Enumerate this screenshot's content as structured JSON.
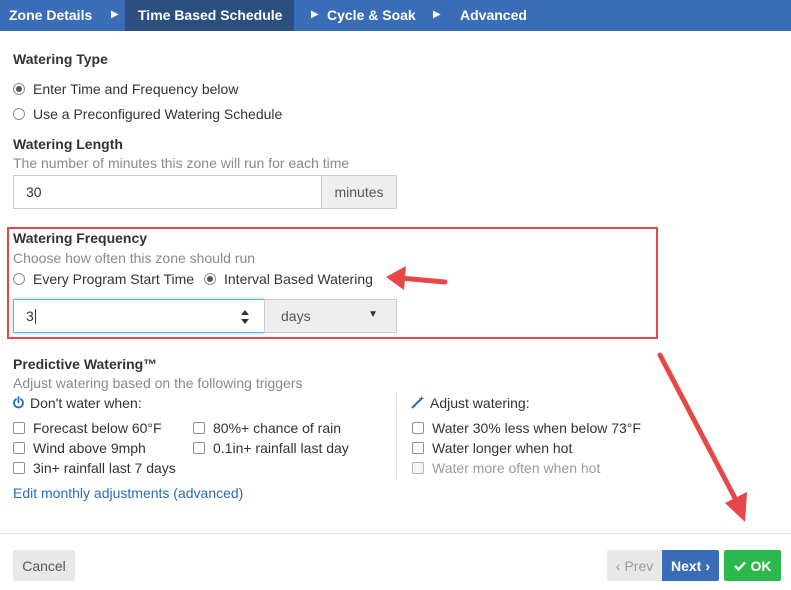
{
  "tabs": [
    {
      "label": "Zone Details"
    },
    {
      "label": "Time Based Schedule"
    },
    {
      "label": "Cycle & Soak"
    },
    {
      "label": "Advanced"
    }
  ],
  "watering_type": {
    "title": "Watering Type",
    "options": [
      {
        "label": "Enter Time and Frequency below",
        "selected": true
      },
      {
        "label": "Use a Preconfigured Watering Schedule",
        "selected": false
      }
    ]
  },
  "watering_length": {
    "title": "Watering Length",
    "hint": "The number of minutes this zone will run for each time",
    "value": "30",
    "unit": "minutes"
  },
  "watering_frequency": {
    "title": "Watering Frequency",
    "hint": "Choose how often this zone should run",
    "options": [
      {
        "label": "Every Program Start Time",
        "selected": false
      },
      {
        "label": "Interval Based Watering",
        "selected": true
      }
    ],
    "interval_value": "3",
    "interval_unit": "days",
    "highlight_color": "#e8474a"
  },
  "predictive": {
    "title": "Predictive Watering™",
    "hint": "Adjust watering based on the following triggers",
    "dont_water_heading": "Don't water when:",
    "dont_water": [
      {
        "label": "Forecast below 60°F",
        "checked": false
      },
      {
        "label": "80%+ chance of rain",
        "checked": false
      },
      {
        "label": "Wind above 9mph",
        "checked": false
      },
      {
        "label": "0.1in+ rainfall last day",
        "checked": false
      },
      {
        "label": "3in+ rainfall last 7 days",
        "checked": false
      }
    ],
    "adjust_heading": "Adjust watering:",
    "adjust": [
      {
        "label": "Water 30% less when below 73°F",
        "checked": false,
        "enabled": true
      },
      {
        "label": "Water longer when hot",
        "checked": false,
        "enabled": true
      },
      {
        "label": "Water more often when hot",
        "checked": false,
        "enabled": false
      }
    ],
    "monthly_link": "Edit monthly adjustments (advanced)"
  },
  "footer": {
    "cancel": "Cancel",
    "prev": "Prev",
    "next": "Next",
    "ok": "OK"
  },
  "colors": {
    "tab_bar": "#3a6db5",
    "tab_active": "#2c4f80",
    "next_button": "#3a6db5",
    "ok_button": "#2db84d",
    "annotation_arrow": "#e8474a"
  }
}
